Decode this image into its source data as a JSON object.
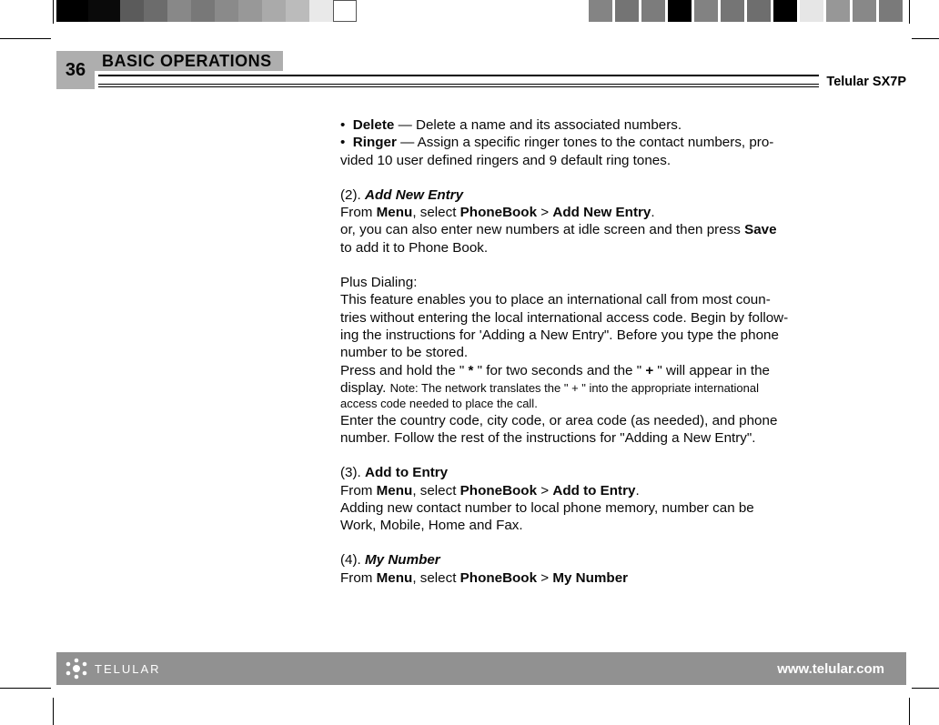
{
  "page_number": "36",
  "section_title": "BASIC OPERATIONS",
  "product_name": "Telular SX7P",
  "body": {
    "bullet1_bold": "Delete",
    "bullet1_rest": " — Delete a name and its associated numbers.",
    "bullet2_bold": "Ringer",
    "bullet2_rest1": " — Assign a specific ringer tones to the contact numbers, pro-",
    "bullet2_rest2": "vided 10 user defined ringers  and 9 default ring tones.",
    "s2_heading_prefix": "(2). ",
    "s2_heading": "Add New Entry",
    "s2_line1_a": "From ",
    "s2_line1_b": "Menu",
    "s2_line1_c": ", select ",
    "s2_line1_d": "PhoneBook",
    "s2_line1_e": " > ",
    "s2_line1_f": "Add New Entry",
    "s2_line1_g": ".",
    "s2_line2_a": "or, you can also enter new numbers at idle screen and then press ",
    "s2_line2_b": "Save",
    "s2_line3": "to add it to Phone Book.",
    "plus_title": "Plus Dialing:",
    "plus_l1": "This feature enables you to place an international call from most coun-",
    "plus_l2": "tries without entering the local international access code. Begin by follow-",
    "plus_l3": "ing the instructions for 'Adding a New Entry\". Before you type the phone",
    "plus_l4": "number to be stored.",
    "plus_l5_a": "Press and hold the \" ",
    "plus_l5_b": "*",
    "plus_l5_c": " \" for two seconds and the  \" ",
    "plus_l5_d": "+",
    "plus_l5_e": " \" will appear in the",
    "plus_l6_a": "display. ",
    "plus_note1": "Note: The network translates the \" + \" into the appropriate international",
    "plus_note2": "access  code needed to place the call.",
    "plus_l7": "Enter the country code, city code, or area code (as needed), and phone",
    "plus_l8": "number. Follow the rest of the instructions for \"Adding a New Entry\".",
    "s3_heading_prefix": "(3). ",
    "s3_heading": "Add to Entry",
    "s3_line1_a": "From ",
    "s3_line1_b": "Menu",
    "s3_line1_c": ", select ",
    "s3_line1_d": "PhoneBook",
    "s3_line1_e": " > ",
    "s3_line1_f": "Add to Entry",
    "s3_line1_g": ".",
    "s3_line2": "Adding new contact number to local phone memory, number can be",
    "s3_line3": "Work, Mobile, Home and Fax.",
    "s4_heading_prefix": "(4). ",
    "s4_heading": "My Number",
    "s4_line1_a": "From ",
    "s4_line1_b": "Menu",
    "s4_line1_c": ", select ",
    "s4_line1_d": "PhoneBook",
    "s4_line1_e": " > ",
    "s4_line1_f": "My Number"
  },
  "footer": {
    "brand": "TELULAR",
    "url": "www.telular.com"
  }
}
